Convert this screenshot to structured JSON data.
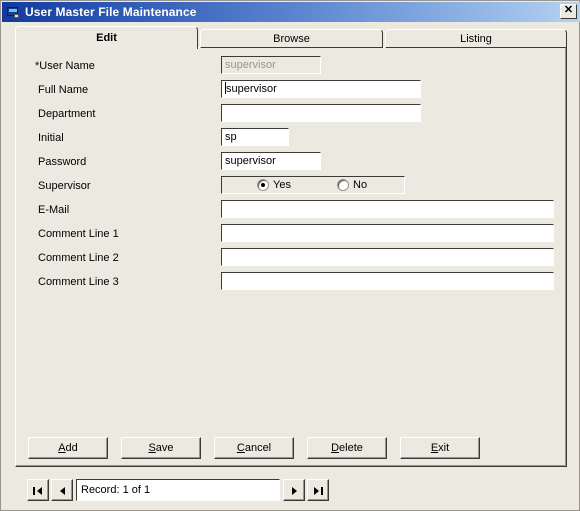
{
  "window": {
    "title": "User Master File Maintenance",
    "icon": "form-window-icon",
    "close_label": "✕"
  },
  "tabs": [
    {
      "label": "Edit",
      "active": true
    },
    {
      "label": "Browse",
      "active": false
    },
    {
      "label": "Listing",
      "active": false
    }
  ],
  "form": {
    "fields": [
      {
        "label": "*User Name",
        "value": "supervisor",
        "placeholder": "",
        "disabled": true,
        "focused": false
      },
      {
        "label": "Full Name",
        "value": "supervisor",
        "placeholder": "",
        "disabled": false,
        "focused": true
      },
      {
        "label": "Department",
        "value": "",
        "placeholder": "",
        "disabled": false,
        "focused": false
      },
      {
        "label": "Initial",
        "value": "sp",
        "placeholder": "",
        "disabled": false,
        "focused": false
      },
      {
        "label": "Password",
        "value": "supervisor",
        "placeholder": "",
        "disabled": false,
        "focused": false
      },
      {
        "label": "Supervisor",
        "value": "Yes",
        "placeholder": "",
        "disabled": false,
        "focused": false
      },
      {
        "label": "E-Mail",
        "value": "",
        "placeholder": "",
        "disabled": false,
        "focused": false
      },
      {
        "label": "Comment Line 1",
        "value": "",
        "placeholder": "",
        "disabled": false,
        "focused": false
      },
      {
        "label": "Comment Line 2",
        "value": "",
        "placeholder": "",
        "disabled": false,
        "focused": false
      },
      {
        "label": "Comment Line 3",
        "value": "",
        "placeholder": "",
        "disabled": false,
        "focused": false
      }
    ],
    "supervisor_options": [
      {
        "label": "Yes",
        "selected": true
      },
      {
        "label": "No",
        "selected": false
      }
    ]
  },
  "buttons": [
    {
      "label": "Add",
      "accel": "A"
    },
    {
      "label": "Save",
      "accel": "S"
    },
    {
      "label": "Cancel",
      "accel": "C"
    },
    {
      "label": "Delete",
      "accel": "D"
    },
    {
      "label": "Exit",
      "accel": "E"
    }
  ],
  "navigator": {
    "first_icon": "first-record-icon",
    "prev_icon": "previous-record-icon",
    "next_icon": "next-record-icon",
    "last_icon": "last-record-icon",
    "record_text": "Record: 1 of 1"
  },
  "colors": {
    "face": "#ece9e0",
    "title_start": "#13399c",
    "title_end": "#b5d2f2",
    "disabled_text": "#9a968e"
  }
}
